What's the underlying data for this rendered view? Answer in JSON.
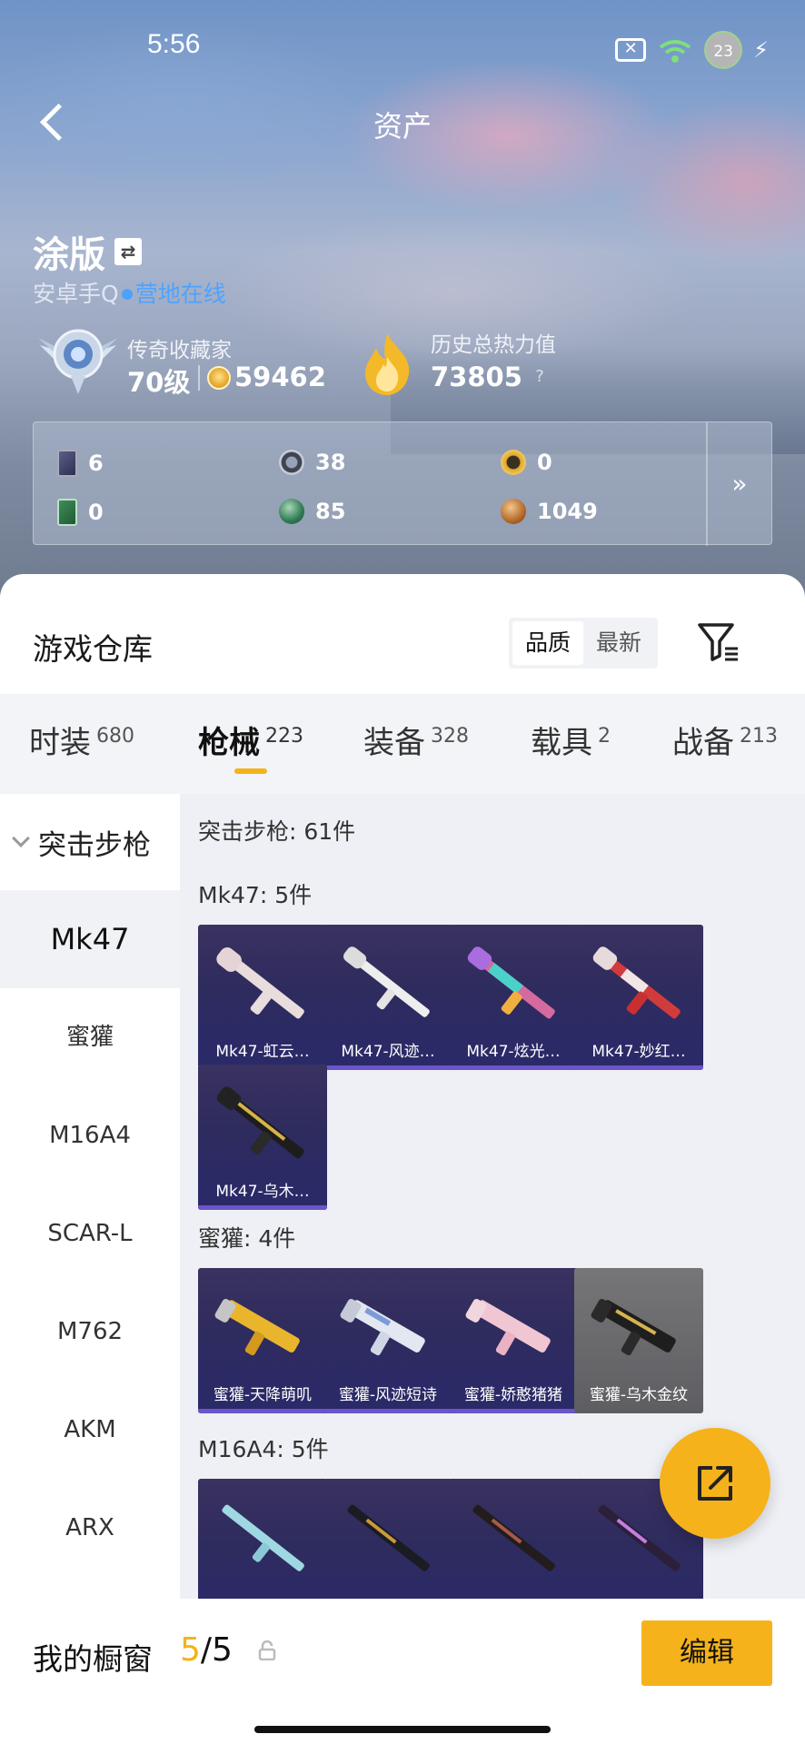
{
  "status_bar": {
    "time": "5:56",
    "battery_level": "23"
  },
  "nav": {
    "title": "资产"
  },
  "user": {
    "name": "涂版",
    "platform": "安卓手Q",
    "status": "营地在线",
    "rank_title": "传奇收藏家",
    "level": "70级",
    "coins": "59462",
    "heat_label": "历史总热力值",
    "heat_value": "73805",
    "help": "?"
  },
  "resources": [
    {
      "icon": "card-icon",
      "value": "6"
    },
    {
      "icon": "silver-coin-icon",
      "value": "38"
    },
    {
      "icon": "gold-token-icon",
      "value": "0"
    },
    {
      "icon": "green-card-icon",
      "value": "0"
    },
    {
      "icon": "green-orb-icon",
      "value": "85"
    },
    {
      "icon": "bronze-coin-icon",
      "value": "1049"
    }
  ],
  "resources_more": "»",
  "warehouse": {
    "title": "游戏仓库",
    "sort_options": [
      "品质",
      "最新"
    ],
    "sort_active": 0
  },
  "tabs": [
    {
      "label": "时装",
      "count": "680"
    },
    {
      "label": "枪械",
      "count": "223"
    },
    {
      "label": "装备",
      "count": "328"
    },
    {
      "label": "载具",
      "count": "2"
    },
    {
      "label": "战备",
      "count": "213"
    }
  ],
  "active_tab": 1,
  "sidebar": {
    "category": "突击步枪",
    "items": [
      "Mk47",
      "蜜獾",
      "M16A4",
      "SCAR-L",
      "M762",
      "AKM",
      "ARX"
    ],
    "active": 0
  },
  "content": {
    "category_header": "突击步枪: 61件",
    "groups": [
      {
        "header": "Mk47: 5件",
        "items": [
          "Mk47-虹云…",
          "Mk47-风迹…",
          "Mk47-炫光…",
          "Mk47-妙红…",
          "Mk47-乌木…"
        ]
      },
      {
        "header": "蜜獾: 4件",
        "items": [
          "蜜獾-天降萌叽",
          "蜜獾-风迹短诗",
          "蜜獾-娇憨猪猪",
          "蜜獾-乌木金纹"
        ]
      },
      {
        "header": "M16A4: 5件",
        "items": [
          "",
          "",
          "",
          ""
        ]
      }
    ]
  },
  "showcase": {
    "label": "我的橱窗",
    "current": "5",
    "total": "/5",
    "edit_label": "编辑"
  },
  "colors": {
    "accent": "#f5b21a",
    "online_blue": "#4ea2ff",
    "card_bg": "#2e2b5e"
  }
}
